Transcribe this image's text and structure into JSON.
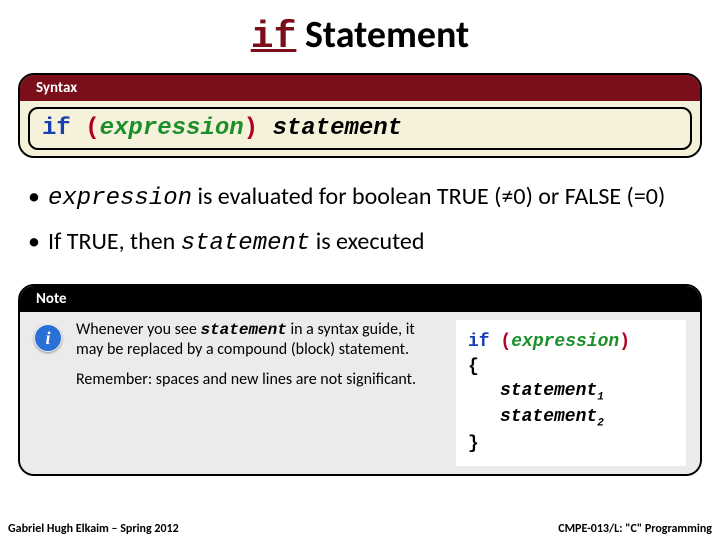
{
  "title": {
    "keyword": "if",
    "rest": " Statement"
  },
  "syntax": {
    "header": "Syntax",
    "kw": "if ",
    "lp": "(",
    "expr": "expression",
    "rp": ")",
    "stmt": " statement"
  },
  "bullets": {
    "b1_expr": "expression",
    "b1_rest": " is evaluated for boolean TRUE (≠0) or FALSE (=0)",
    "b2_pre": "If TRUE, then ",
    "b2_stmt": "statement",
    "b2_post": " is executed"
  },
  "note": {
    "header": "Note",
    "icon": "i",
    "p1_pre": "Whenever you see ",
    "p1_code": "statement",
    "p1_post": " in a syntax guide, it may be replaced by a compound (block) statement.",
    "p2": "Remember: spaces and new lines are not significant.",
    "code": {
      "kw": "if ",
      "lp": "(",
      "expr": "expression",
      "rp": ")",
      "lb": "{",
      "s1": "statement",
      "sub1": "1",
      "s2": "statement",
      "sub2": "2",
      "rb": "}"
    }
  },
  "footer": {
    "left": "Gabriel Hugh Elkaim – Spring 2012",
    "right": "CMPE-013/L: \"C\" Programming"
  }
}
